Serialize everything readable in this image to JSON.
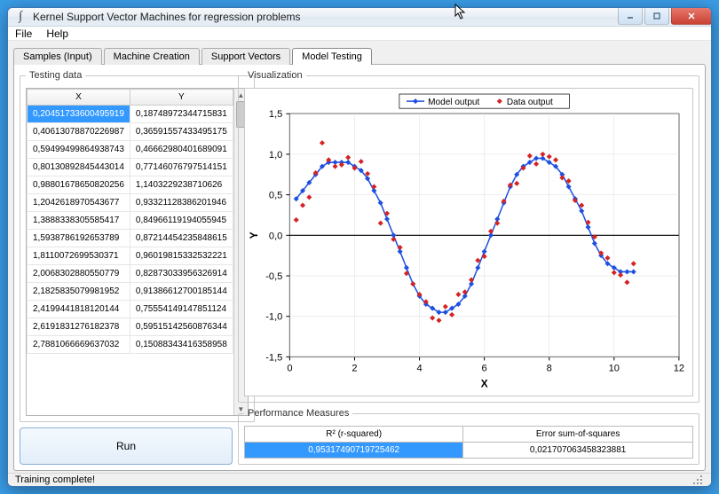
{
  "title": "Kernel Support Vector Machines for regression problems",
  "menu": {
    "file": "File",
    "help": "Help"
  },
  "tabs": {
    "samples": "Samples (Input)",
    "machine": "Machine Creation",
    "vectors": "Support Vectors",
    "testing": "Model Testing"
  },
  "panels": {
    "testing_data": "Testing data",
    "visualization": "Visualization",
    "performance": "Performance Measures"
  },
  "grid": {
    "col_x": "X",
    "col_y": "Y",
    "rows": [
      {
        "x": "0,20451733600495919",
        "y": "0,18748972344715831"
      },
      {
        "x": "0,40613078870226987",
        "y": "0,36591557433495175"
      },
      {
        "x": "0,59499499864938743",
        "y": "0,46662980401689091"
      },
      {
        "x": "0,80130892845443014",
        "y": "0,77146076797514151"
      },
      {
        "x": "0,98801678650820256",
        "y": "1,1403229238710626"
      },
      {
        "x": "1,2042618970543677",
        "y": "0,93321128386201946"
      },
      {
        "x": "1,3888338305585417",
        "y": "0,84966119194055945"
      },
      {
        "x": "1,5938786192653789",
        "y": "0,87214454235848615"
      },
      {
        "x": "1,8110072699530371",
        "y": "0,96019815332532221"
      },
      {
        "x": "2,0068302880550779",
        "y": "0,82873033956326914"
      },
      {
        "x": "2,1825835079981952",
        "y": "0,91386612700185144"
      },
      {
        "x": "2,4199441818120144",
        "y": "0,75554149147851124"
      },
      {
        "x": "2,6191831276182378",
        "y": "0,59515142560876344"
      },
      {
        "x": "2,7881066669637032",
        "y": "0,15088343416358958"
      }
    ]
  },
  "run_label": "Run",
  "legend": {
    "model": "Model output",
    "data": "Data output"
  },
  "axes": {
    "x_label": "X",
    "y_label": "Y"
  },
  "chart_data": {
    "type": "scatter-line",
    "xlabel": "X",
    "ylabel": "Y",
    "xlim": [
      0,
      12
    ],
    "ylim": [
      -1.5,
      1.5
    ],
    "xticks": [
      0,
      2,
      4,
      6,
      8,
      10,
      12
    ],
    "yticks": [
      -1.5,
      -1.0,
      -0.5,
      0.0,
      0.5,
      1.0,
      1.5
    ],
    "series": [
      {
        "name": "Model output",
        "style": "line+markers",
        "color": "#1e50e0",
        "x": [
          0.2,
          0.4,
          0.6,
          0.8,
          1.0,
          1.2,
          1.4,
          1.6,
          1.8,
          2.0,
          2.2,
          2.4,
          2.6,
          2.8,
          3.0,
          3.2,
          3.4,
          3.6,
          3.8,
          4.0,
          4.2,
          4.4,
          4.6,
          4.8,
          5.0,
          5.2,
          5.4,
          5.6,
          5.8,
          6.0,
          6.2,
          6.4,
          6.6,
          6.8,
          7.0,
          7.2,
          7.4,
          7.6,
          7.8,
          8.0,
          8.2,
          8.4,
          8.6,
          8.8,
          9.0,
          9.2,
          9.4,
          9.6,
          9.8,
          10.0,
          10.2,
          10.4,
          10.6
        ],
        "y": [
          0.45,
          0.55,
          0.65,
          0.75,
          0.85,
          0.9,
          0.9,
          0.9,
          0.9,
          0.85,
          0.8,
          0.7,
          0.55,
          0.4,
          0.2,
          0.0,
          -0.2,
          -0.4,
          -0.6,
          -0.75,
          -0.85,
          -0.9,
          -0.95,
          -0.95,
          -0.9,
          -0.85,
          -0.75,
          -0.6,
          -0.4,
          -0.2,
          0.0,
          0.2,
          0.4,
          0.6,
          0.75,
          0.85,
          0.9,
          0.95,
          0.95,
          0.9,
          0.85,
          0.75,
          0.6,
          0.45,
          0.3,
          0.1,
          -0.1,
          -0.25,
          -0.35,
          -0.4,
          -0.45,
          -0.45,
          -0.45
        ]
      },
      {
        "name": "Data output",
        "style": "markers",
        "color": "#d62222",
        "x": [
          0.2,
          0.4,
          0.6,
          0.8,
          1.0,
          1.2,
          1.4,
          1.6,
          1.8,
          2.0,
          2.2,
          2.4,
          2.6,
          2.8,
          3.0,
          3.2,
          3.4,
          3.6,
          3.8,
          4.0,
          4.2,
          4.4,
          4.6,
          4.8,
          5.0,
          5.2,
          5.4,
          5.6,
          5.8,
          6.0,
          6.2,
          6.4,
          6.6,
          6.8,
          7.0,
          7.2,
          7.4,
          7.6,
          7.8,
          8.0,
          8.2,
          8.4,
          8.6,
          8.8,
          9.0,
          9.2,
          9.4,
          9.6,
          9.8,
          10.0,
          10.2,
          10.4,
          10.6
        ],
        "y": [
          0.19,
          0.37,
          0.47,
          0.77,
          1.14,
          0.93,
          0.85,
          0.87,
          0.96,
          0.83,
          0.91,
          0.76,
          0.6,
          0.15,
          0.27,
          -0.05,
          -0.15,
          -0.47,
          -0.6,
          -0.73,
          -0.82,
          -1.02,
          -1.05,
          -0.88,
          -0.98,
          -0.73,
          -0.7,
          -0.55,
          -0.31,
          -0.26,
          0.05,
          0.15,
          0.42,
          0.62,
          0.64,
          0.83,
          0.98,
          0.88,
          1.0,
          0.97,
          0.93,
          0.71,
          0.67,
          0.43,
          0.37,
          0.16,
          -0.02,
          -0.22,
          -0.28,
          -0.46,
          -0.49,
          -0.58,
          -0.35
        ]
      }
    ]
  },
  "performance": {
    "r2_label": "R² (r-squared)",
    "sse_label": "Error sum-of-squares",
    "r2_value": "0,95317490719725462",
    "sse_value": "0,021707063458323881"
  },
  "status": "Training complete!"
}
